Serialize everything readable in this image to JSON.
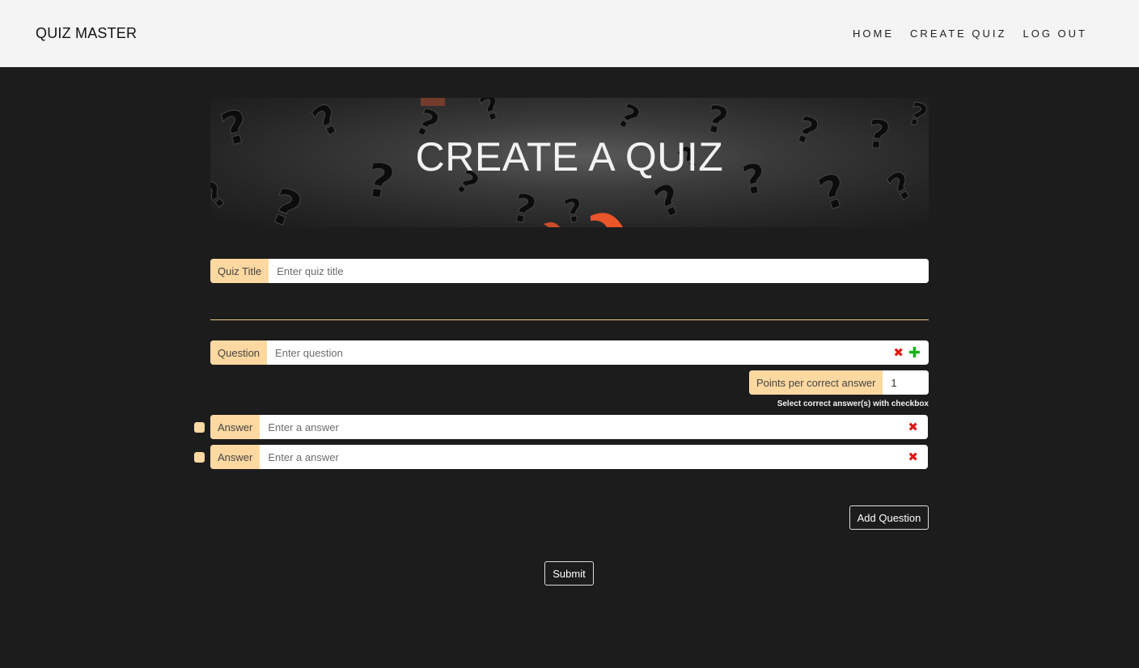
{
  "nav": {
    "brand": "QUIZ MASTER",
    "links": [
      "HOME",
      "CREATE QUIZ",
      "LOG OUT"
    ]
  },
  "banner": {
    "title": "CREATE A QUIZ"
  },
  "quiz_title": {
    "label": "Quiz Title",
    "placeholder": "Enter quiz title",
    "value": ""
  },
  "question": {
    "label": "Question",
    "placeholder": "Enter question",
    "value": "",
    "remove_icon": "close-icon",
    "add_icon": "plus-icon"
  },
  "points": {
    "label": "Points per correct answer",
    "value": "1"
  },
  "hint": "Select correct answer(s) with checkbox",
  "answers": [
    {
      "label": "Answer",
      "placeholder": "Enter a answer",
      "value": "",
      "checked": false
    },
    {
      "label": "Answer",
      "placeholder": "Enter a answer",
      "value": "",
      "checked": false
    }
  ],
  "buttons": {
    "add_question": "Add Question",
    "submit": "Submit"
  },
  "colors": {
    "background": "#1c1c1c",
    "navbar": "#f4f4f4",
    "addon": "#fdd8a0",
    "divider": "#f0c989",
    "remove": "#e41818",
    "add": "#19b219",
    "accent_orange": "#ff5a2a"
  }
}
